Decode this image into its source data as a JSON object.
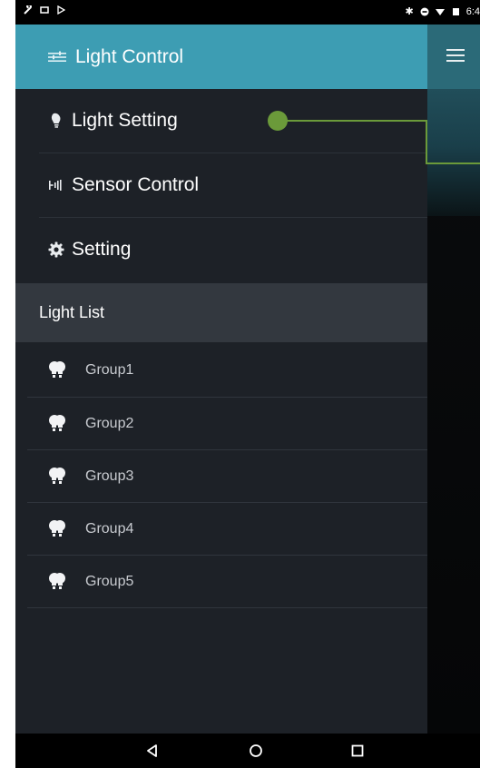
{
  "app": {
    "header_title": "Light Control"
  },
  "status_bar": {
    "time": "6:4"
  },
  "menu": {
    "items": [
      {
        "label": "Light Setting",
        "icon": "lightbulb-icon"
      },
      {
        "label": "Sensor Control",
        "icon": "sensor-icon"
      },
      {
        "label": "Setting",
        "icon": "gear-icon"
      }
    ]
  },
  "light_list": {
    "header": "Light List",
    "groups": [
      {
        "label": "Group1",
        "icon": "bulbs-icon"
      },
      {
        "label": "Group2",
        "icon": "bulbs-icon"
      },
      {
        "label": "Group3",
        "icon": "bulbs-icon"
      },
      {
        "label": "Group4",
        "icon": "bulbs-icon"
      },
      {
        "label": "Group5",
        "icon": "bulbs-icon"
      }
    ]
  },
  "colors": {
    "header_teal": "#3d9db3",
    "drawer_bg": "#1d2127",
    "list_header_bg": "#33383f",
    "callout_green": "#6b9a3a"
  }
}
